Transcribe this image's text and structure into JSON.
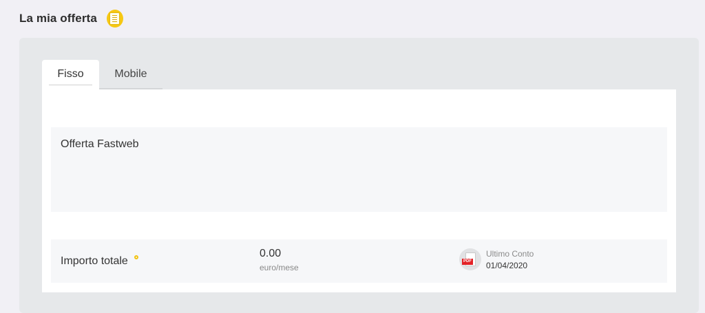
{
  "header": {
    "title": "La mia offerta",
    "icon": "offer-document-icon"
  },
  "tabs": [
    {
      "label": "Fisso",
      "active": true
    },
    {
      "label": "Mobile",
      "active": false
    }
  ],
  "offer": {
    "name": "Offerta Fastweb"
  },
  "total": {
    "label": "Importo totale",
    "value": "0.00",
    "unit": "euro/mese",
    "info_icon": "info-dot-icon"
  },
  "bill": {
    "icon": "pdf-icon",
    "icon_badge": "PDF",
    "label": "Ultimo Conto",
    "date": "01/04/2020"
  },
  "colors": {
    "accent": "#f6c814",
    "pdf_red": "#e32227",
    "background": "#f1f0f5",
    "card": "#e6e8ea"
  }
}
